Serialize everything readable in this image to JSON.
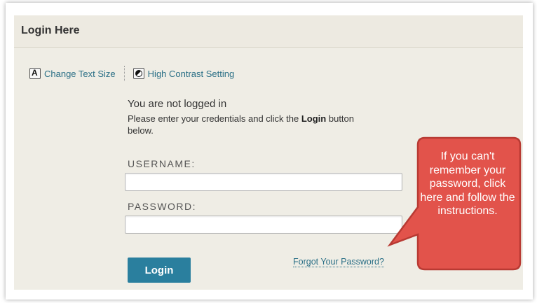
{
  "panel": {
    "title": "Login Here"
  },
  "accessibility": {
    "text_size_label": "Change Text Size",
    "text_size_icon": "text-size-icon",
    "contrast_label": "High Contrast Setting",
    "contrast_icon": "contrast-icon"
  },
  "login": {
    "status": "You are not logged in",
    "instructions_prefix": "Please enter your credentials and click the ",
    "instructions_bold": "Login",
    "instructions_suffix": " button below.",
    "username_label": "USERNAME:",
    "username_value": "",
    "password_label": "PASSWORD:",
    "password_value": "",
    "login_button": "Login",
    "forgot_link": "Forgot Your Password?"
  },
  "callout": {
    "text": "If you can't remember your password, click here and follow the instructions.",
    "fill_color": "#e2534b",
    "border_color": "#b83a33"
  }
}
